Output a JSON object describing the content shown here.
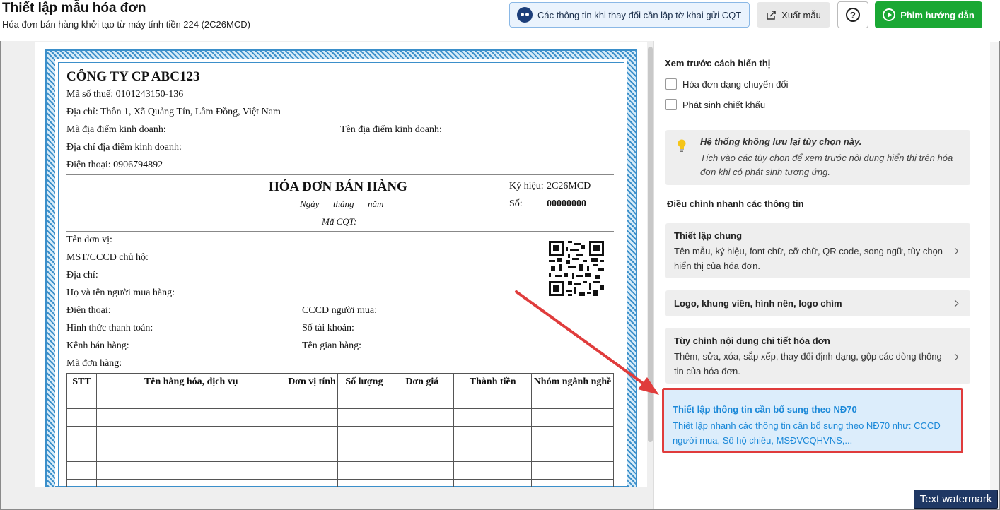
{
  "header": {
    "title": "Thiết lập mẫu hóa đơn",
    "subtitle": "Hóa đơn bán hàng khởi tạo từ máy tính tiền 224 (2C26MCD)",
    "info_button": "Các thông tin khi thay đổi cần lập tờ khai gửi CQT",
    "export_button": "Xuất mẫu",
    "guide_button": "Phim hướng dẫn",
    "colors": {
      "guide": "#1aa834",
      "info_bg": "#eaf3fd",
      "highlight": "#e03c3c"
    }
  },
  "invoice": {
    "company": "CÔNG TY CP ABC123",
    "tax_code": "Mã số thuế: 0101243150-136",
    "address": "Địa chỉ: Thôn 1, Xã Quảng Tín, Lâm Đồng, Việt Nam",
    "business_location_code": "Mã địa điểm kinh doanh:",
    "business_location_name": "Tên địa điểm kinh doanh:",
    "business_location_address": "Địa chỉ địa điểm kinh doanh:",
    "phone": "Điện thoại: 0906794892",
    "title": "HÓA ĐƠN BÁN HÀNG",
    "date_line": "Ngày      tháng      năm",
    "cqt_code": "Mã CQT:",
    "symbol_label": "Ký hiệu:",
    "symbol_value": "2C26MCD",
    "number_label": "Số:",
    "number_value": "00000000",
    "buyer_unit": "Tên đơn vị:",
    "buyer_tax": "MST/CCCD chủ hộ:",
    "buyer_address": "Địa chỉ:",
    "buyer_name": "Họ và tên người mua hàng:",
    "buyer_phone": "Điện thoại:",
    "buyer_id": "CCCD người mua:",
    "payment_method": "Hình thức thanh toán:",
    "account_no": "Số tài khoản:",
    "sales_channel": "Kênh bán hàng:",
    "store_name": "Tên gian hàng:",
    "order_code": "Mã đơn hàng:",
    "columns": [
      "STT",
      "Tên hàng hóa, dịch vụ",
      "Đơn vị tính",
      "Số lượng",
      "Đơn giá",
      "Thành tiền",
      "Nhóm ngành nghề"
    ]
  },
  "panel": {
    "preview_title": "Xem trước cách hiển thị",
    "options": [
      "Hóa đơn dạng chuyển đổi",
      "Phát sinh chiết khấu"
    ],
    "note_title": "Hệ thống không lưu lại tùy chọn này.",
    "note_body": "Tích vào các tùy chọn để xem trước nội dung hiển thị trên hóa đơn khi có phát sinh tương ứng.",
    "quick_title": "Điều chỉnh nhanh các thông tin",
    "cards": [
      {
        "title": "Thiết lập chung",
        "desc": "Tên mẫu, ký hiệu, font chữ, cỡ chữ, QR code, song ngữ, tùy chọn hiển thị của hóa đơn."
      },
      {
        "title": "Logo, khung viền, hình nền, logo chìm",
        "desc": ""
      },
      {
        "title": "Tùy chỉnh nội dung chi tiết hóa đơn",
        "desc": "Thêm, sửa, xóa, sắp xếp, thay đổi định dạng, gộp các dòng thông tin của hóa đơn."
      },
      {
        "title": "Thiết lập thông tin cần bổ sung theo NĐ70",
        "desc": "Thiết lập nhanh các thông tin cần bổ sung theo NĐ70 như: CCCD người mua, Số hộ chiếu, MSĐVCQHVNS,..."
      }
    ]
  },
  "watermark": "Text watermark"
}
